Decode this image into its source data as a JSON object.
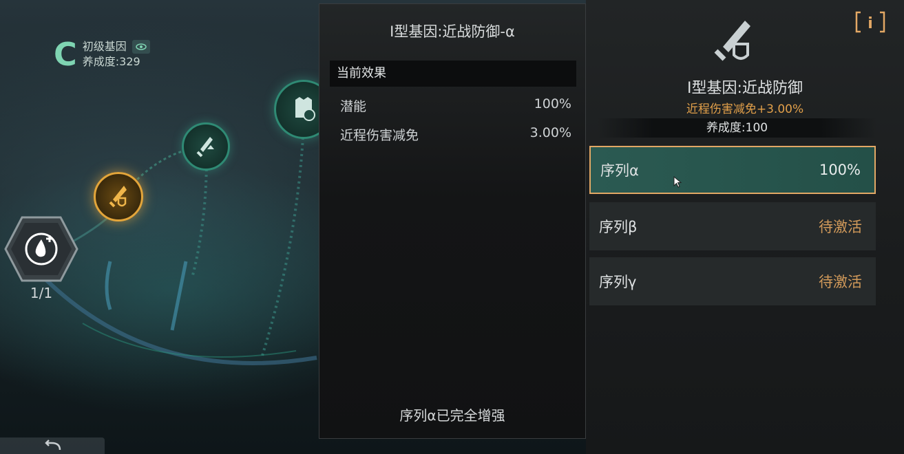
{
  "grade": {
    "letter": "C",
    "tier": "初级基因",
    "cultivation": "养成度:329"
  },
  "skill_tree": {
    "potion_count": "1/1"
  },
  "mid_panel": {
    "title": "I型基因:近战防御-α",
    "effect_header": "当前效果",
    "effects": [
      {
        "label": "潜能",
        "value": "100%"
      },
      {
        "label": "近程伤害减免",
        "value": "3.00%"
      }
    ],
    "footer": "序列α已完全增强"
  },
  "right_panel": {
    "info_label": "i",
    "gene_name": "I型基因:近战防御",
    "gene_bonus": "近程伤害减免+3.00%",
    "gene_level": "养成度:100",
    "sequences": [
      {
        "label": "序列α",
        "status": "100%"
      },
      {
        "label": "序列β",
        "status": "待激活"
      },
      {
        "label": "序列γ",
        "status": "待激活"
      }
    ]
  },
  "colors": {
    "accent_gold": "#e3a865",
    "accent_teal": "#2b5a52",
    "pending_orange": "#d29a5a",
    "grade_green": "#7fd4b2"
  }
}
